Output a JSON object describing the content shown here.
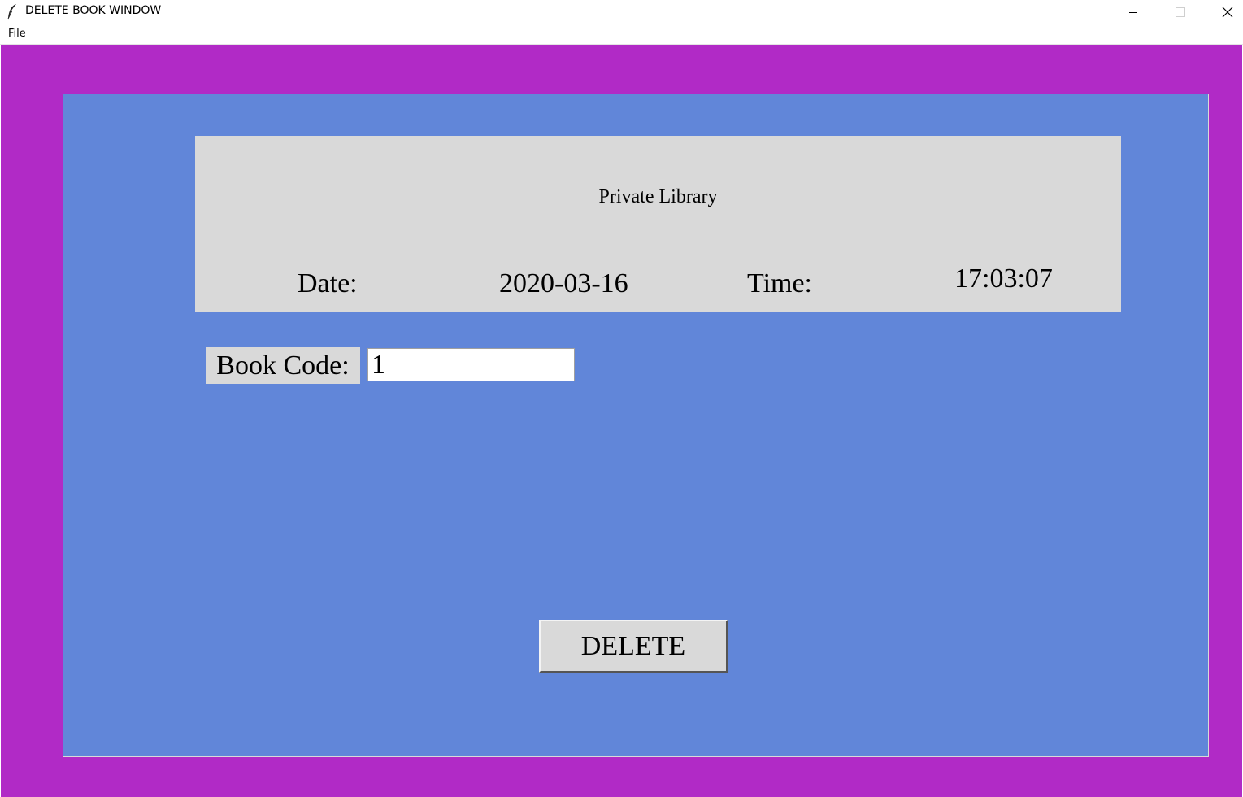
{
  "window": {
    "title": "DELETE BOOK WINDOW",
    "app_icon": "feather-icon",
    "controls": [
      "minimize-icon",
      "maximize-icon",
      "close-icon"
    ]
  },
  "menubar": {
    "items": [
      {
        "label": "File"
      }
    ]
  },
  "header": {
    "library_title": "Private Library",
    "date_label": "Date:",
    "date_value": "2020-03-16",
    "time_label": "Time:",
    "time_value": "17:03:07"
  },
  "form": {
    "book_code_label": "Book Code:",
    "book_code_value": "1"
  },
  "actions": {
    "delete_label": "DELETE"
  },
  "colors": {
    "outer_background": "#b12ac6",
    "inner_background": "#6186d9",
    "panel_background": "#d9d9d9"
  }
}
